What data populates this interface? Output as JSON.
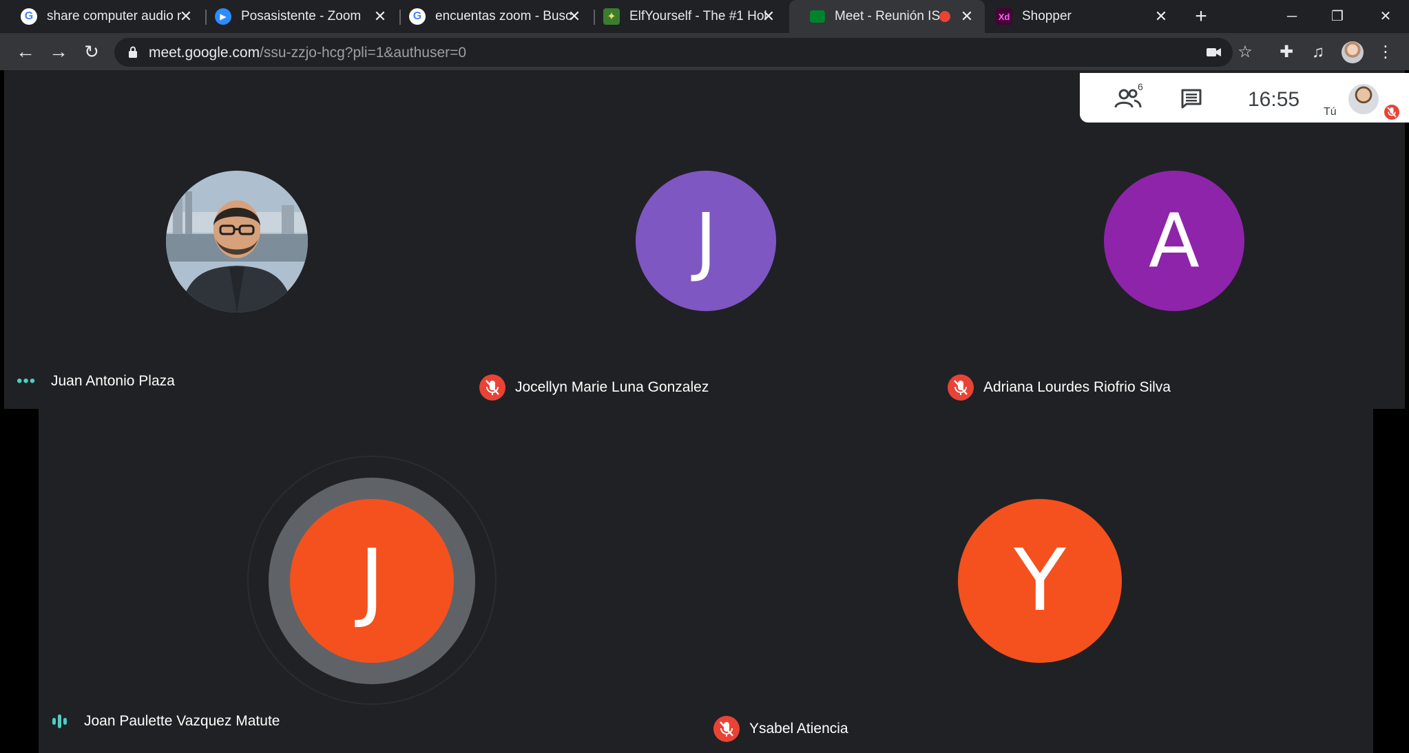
{
  "browser": {
    "tabs": [
      {
        "title": "share computer audio r",
        "favicon": "google-icon",
        "active": false
      },
      {
        "title": "Posasistente - Zoom",
        "favicon": "zoom-icon",
        "active": false
      },
      {
        "title": "encuentas zoom - Busc",
        "favicon": "google-icon",
        "active": false
      },
      {
        "title": "ElfYourself - The #1 Hol",
        "favicon": "elf-icon",
        "active": false
      },
      {
        "title": "Meet - Reunión IS",
        "favicon": "meet-icon",
        "active": true,
        "recording": true
      },
      {
        "title": "Shopper",
        "favicon": "xd-icon",
        "active": false
      }
    ],
    "xd_label": "Xd",
    "url_host": "meet.google.com",
    "url_path": "/ssu-zzjo-hcg?pli=1&authuser=0"
  },
  "meet": {
    "people_count": "6",
    "clock": "16:55",
    "you_label": "Tú",
    "participants": [
      {
        "name": "Juan Antonio Plaza",
        "initial": "",
        "color": "",
        "status": "dots"
      },
      {
        "name": "Jocellyn Marie Luna Gonzalez",
        "initial": "J",
        "color": "#7e57c2",
        "status": "muted"
      },
      {
        "name": "Adriana Lourdes Riofrio Silva",
        "initial": "A",
        "color": "#8e24aa",
        "status": "muted"
      },
      {
        "name": "Joan Paulette Vazquez Matute",
        "initial": "J",
        "color": "#f4511e",
        "status": "speaking"
      },
      {
        "name": "Ysabel Atiencia",
        "initial": "Y",
        "color": "#f4511e",
        "status": "muted"
      }
    ]
  },
  "colors": {
    "chrome_dark": "#202124",
    "chrome_active": "#35363a",
    "muted_red": "#ea4335",
    "speaking_teal": "#4ecdc4"
  }
}
